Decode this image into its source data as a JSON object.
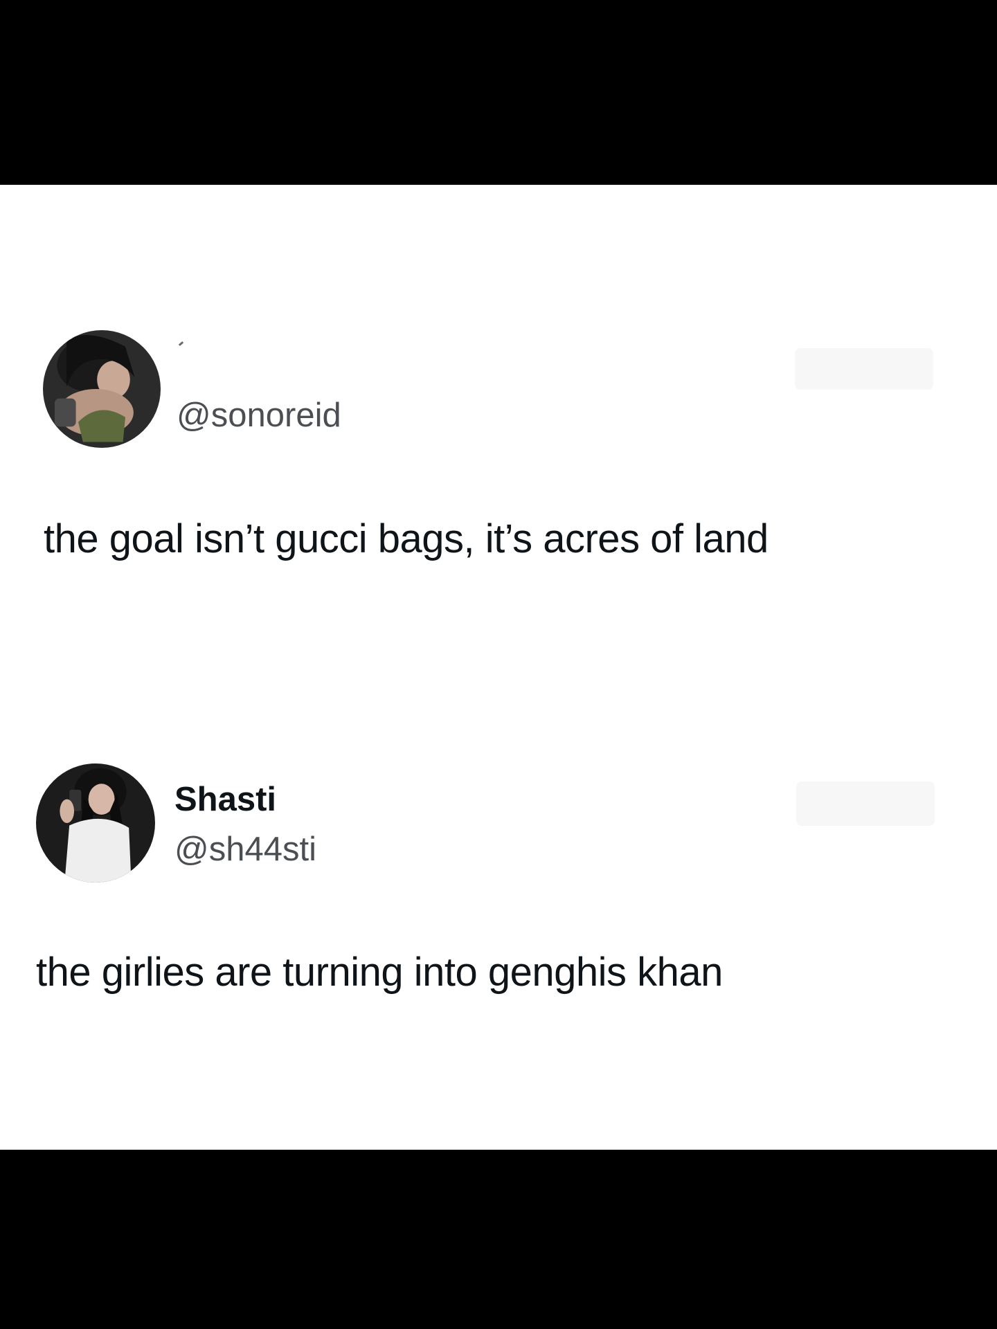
{
  "colors": {
    "background_outer": "#000000",
    "card_background": "#ffffff",
    "text_primary": "#0f1419",
    "text_secondary": "#4b4e52"
  },
  "tweets": [
    {
      "handle": "@sonoreid",
      "text": "the goal isn’t gucci bags, it’s acres of land"
    },
    {
      "display_name": "Shasti",
      "handle": "@sh44sti",
      "text": "the girlies are turning into genghis khan"
    }
  ]
}
